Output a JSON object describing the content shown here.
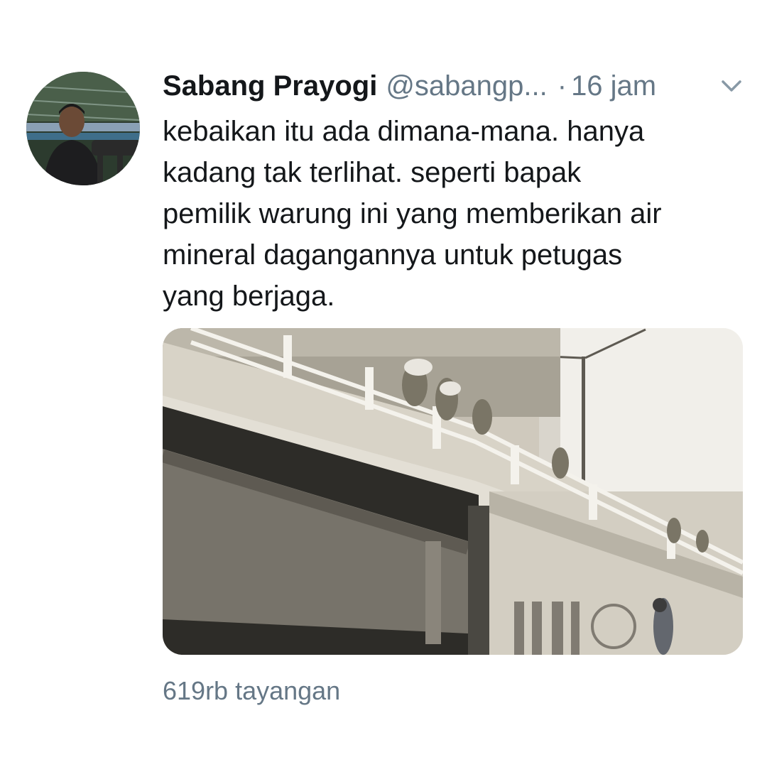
{
  "tweet": {
    "author": {
      "display_name": "Sabang Prayogi",
      "handle": "@sabangp...",
      "avatar_icon": "profile-photo"
    },
    "separator": "·",
    "timestamp": "16 jam",
    "menu_icon": "chevron-down-icon",
    "text_lines": [
      "kebaikan itu ada dimana-mana. hanya",
      "kadang tak terlihat. seperti bapak",
      "pemilik warung ini yang memberikan air",
      "mineral dagangannya untuk petugas",
      "yang berjaga."
    ],
    "media": {
      "type": "image"
    },
    "views": "619rb tayangan"
  },
  "colors": {
    "text_primary": "#14171a",
    "text_secondary": "#657786",
    "background": "#ffffff"
  }
}
